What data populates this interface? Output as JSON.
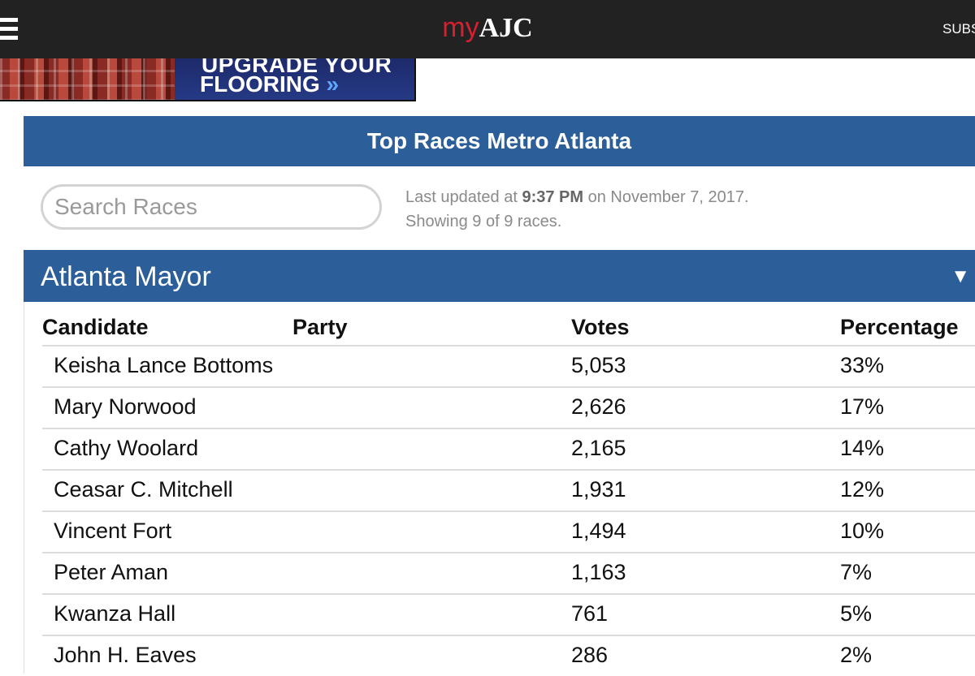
{
  "topbar": {
    "logo_my": "my",
    "logo_ajc": "AJC",
    "subscribe": "SUBS"
  },
  "ad": {
    "line1": "UPGRADE YOUR",
    "line2": "FLOORING",
    "arrows": "»"
  },
  "races": {
    "title": "Top Races Metro Atlanta",
    "search_placeholder": "Search Races",
    "updated_prefix": "Last updated at ",
    "updated_time": "9:37 PM",
    "updated_suffix": " on November 7, 2017.",
    "showing": "Showing 9 of 9 races."
  },
  "race": {
    "title": "Atlanta Mayor",
    "toggle": "▼",
    "columns": {
      "candidate": "Candidate",
      "party": "Party",
      "votes": "Votes",
      "percentage": "Percentage"
    },
    "rows": [
      {
        "candidate": "Keisha Lance Bottoms",
        "party": "",
        "votes": "5,053",
        "percentage": "33%"
      },
      {
        "candidate": "Mary Norwood",
        "party": "",
        "votes": "2,626",
        "percentage": "17%"
      },
      {
        "candidate": "Cathy Woolard",
        "party": "",
        "votes": "2,165",
        "percentage": "14%"
      },
      {
        "candidate": "Ceasar C. Mitchell",
        "party": "",
        "votes": "1,931",
        "percentage": "12%"
      },
      {
        "candidate": "Vincent Fort",
        "party": "",
        "votes": "1,494",
        "percentage": "10%"
      },
      {
        "candidate": "Peter Aman",
        "party": "",
        "votes": "1,163",
        "percentage": "7%"
      },
      {
        "candidate": "Kwanza Hall",
        "party": "",
        "votes": "761",
        "percentage": "5%"
      },
      {
        "candidate": "John H. Eaves",
        "party": "",
        "votes": "286",
        "percentage": "2%"
      }
    ]
  },
  "colors": {
    "topbar": "#222222",
    "header_blue": "#2c5f99",
    "logo_red": "#d6202f"
  }
}
